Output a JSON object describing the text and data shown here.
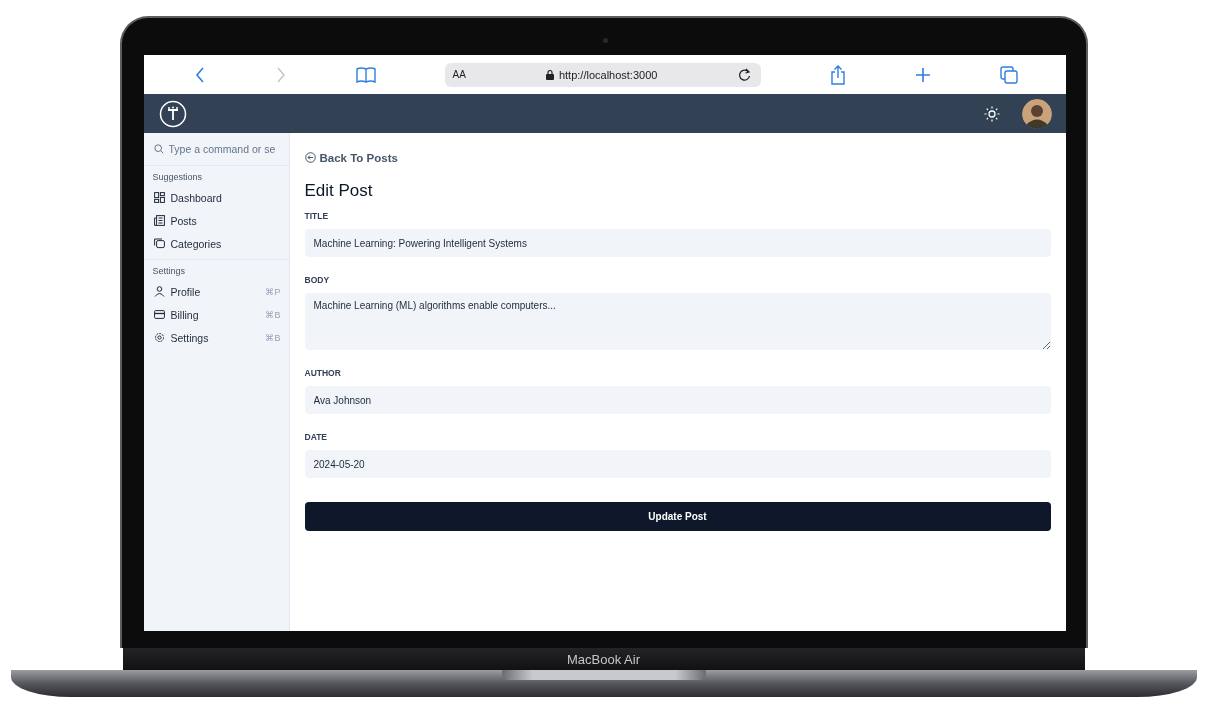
{
  "browser": {
    "reader_label": "AA",
    "url": "http://localhost:3000"
  },
  "sidebar": {
    "search": {
      "placeholder": "Type a command or se"
    },
    "groups": [
      {
        "title": "Suggestions",
        "items": [
          {
            "label": "Dashboard"
          },
          {
            "label": "Posts"
          },
          {
            "label": "Categories"
          }
        ]
      },
      {
        "title": "Settings",
        "items": [
          {
            "label": "Profile",
            "shortcut": "⌘P"
          },
          {
            "label": "Billing",
            "shortcut": "⌘B"
          },
          {
            "label": "Settings",
            "shortcut": "⌘B"
          }
        ]
      }
    ]
  },
  "main": {
    "back_link": "Back To Posts",
    "heading": "Edit Post",
    "fields": [
      {
        "label": "TITLE",
        "kind": "input",
        "value": "Machine Learning: Powering Intelligent Systems"
      },
      {
        "label": "BODY",
        "kind": "textarea",
        "value": "Machine Learning (ML) algorithms enable computers..."
      },
      {
        "label": "AUTHOR",
        "kind": "input",
        "value": "Ava Johnson"
      },
      {
        "label": "DATE",
        "kind": "input",
        "value": "2024-05-20"
      }
    ],
    "submit_button": "Update Post"
  },
  "laptop": {
    "model_label": "MacBook Air"
  }
}
